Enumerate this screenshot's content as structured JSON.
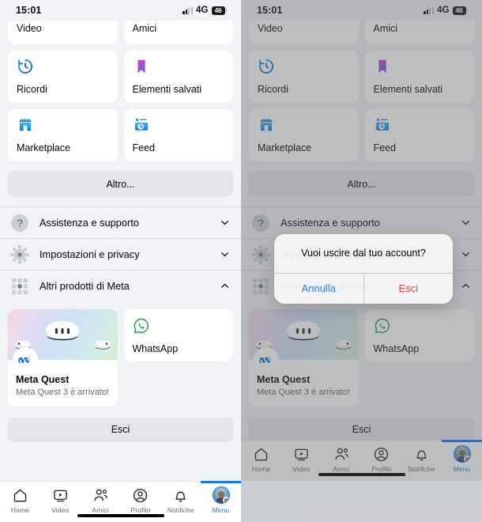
{
  "status": {
    "time": "15:01",
    "network": "4G",
    "battery": "46"
  },
  "menu_grid": [
    {
      "label": "Video",
      "icon": "video-icon",
      "clipped": true
    },
    {
      "label": "Amici",
      "icon": "friends-icon",
      "clipped": true
    },
    {
      "label": "Ricordi",
      "icon": "memories-clock-icon",
      "clipped": false
    },
    {
      "label": "Elementi salvati",
      "icon": "bookmark-icon",
      "clipped": false
    },
    {
      "label": "Marketplace",
      "icon": "marketplace-store-icon",
      "clipped": false
    },
    {
      "label": "Feed",
      "icon": "feed-icon",
      "clipped": false
    }
  ],
  "more_button": "Altro...",
  "sections": [
    {
      "label": "Assistenza e supporto",
      "icon": "help-question-icon",
      "chevron": "down",
      "expanded": false
    },
    {
      "label": "Impostazioni e privacy",
      "icon": "settings-gear-icon",
      "chevron": "down",
      "expanded": false
    },
    {
      "label": "Altri prodotti di Meta",
      "icon": "meta-products-grid-icon",
      "chevron": "up",
      "expanded": true
    }
  ],
  "products": {
    "quest": {
      "title": "Meta Quest",
      "subtitle": "Meta Quest 3 è arrivato!",
      "badge_icon": "meta-infinity-icon"
    },
    "whatsapp": {
      "label": "WhatsApp",
      "icon": "whatsapp-icon"
    }
  },
  "logout_button": "Esci",
  "bottom_nav": [
    {
      "label": "Home",
      "icon": "home-icon",
      "active": false
    },
    {
      "label": "Video",
      "icon": "video-play-icon",
      "active": false
    },
    {
      "label": "Amici",
      "icon": "friends-people-icon",
      "active": false
    },
    {
      "label": "Profilo",
      "icon": "profile-person-icon",
      "active": false
    },
    {
      "label": "Notifiche",
      "icon": "bell-icon",
      "active": false
    },
    {
      "label": "Menu",
      "icon": "avatar-menu-icon",
      "active": true
    }
  ],
  "alert": {
    "title": "Vuoi uscire dal tuo account?",
    "cancel": "Annulla",
    "confirm": "Esci"
  },
  "colors": {
    "accent_blue": "#1877f2",
    "destructive_red": "#e8473f",
    "dialog_blue": "#2c7ef8",
    "page_bg": "#f0f2f5"
  }
}
